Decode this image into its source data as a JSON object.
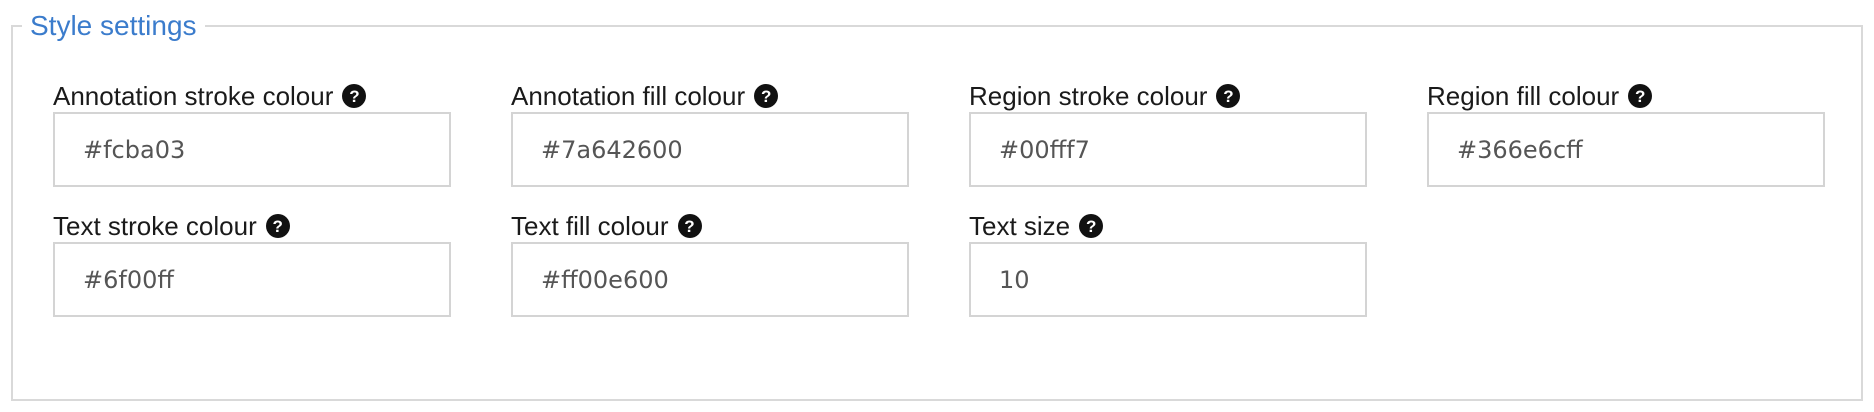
{
  "legend": "Style settings",
  "fields": [
    {
      "label": "Annotation stroke colour",
      "value": "#fcba03",
      "icon": "question-circle-icon"
    },
    {
      "label": "Annotation fill colour",
      "value": "#7a642600",
      "icon": "question-circle-icon"
    },
    {
      "label": "Region stroke colour",
      "value": "#00fff7",
      "icon": "question-circle-icon"
    },
    {
      "label": "Region fill colour",
      "value": "#366e6cff",
      "icon": "question-circle-icon"
    },
    {
      "label": "Text stroke colour",
      "value": "#6f00ff",
      "icon": "question-circle-icon"
    },
    {
      "label": "Text fill colour",
      "value": "#ff00e600",
      "icon": "question-circle-icon"
    },
    {
      "label": "Text size",
      "value": "10",
      "icon": "question-circle-icon"
    }
  ],
  "help_glyph": "?",
  "colors": {
    "legend": "#3b7ccc",
    "border": "#d9d9d9",
    "input_border": "#d4d4d4"
  }
}
